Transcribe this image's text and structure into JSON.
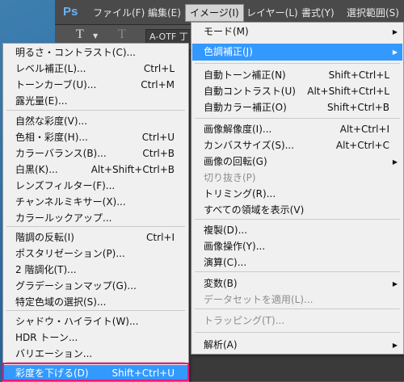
{
  "app": {
    "logo": "Ps"
  },
  "menubar": [
    {
      "label": "ファイル(F)",
      "active": false
    },
    {
      "label": "編集(E)",
      "active": false
    },
    {
      "label": "イメージ(I)",
      "active": true
    },
    {
      "label": "レイヤー(L)",
      "active": false
    },
    {
      "label": "書式(Y)",
      "active": false
    },
    {
      "label": "選択範囲(S)",
      "active": false
    }
  ],
  "options": {
    "font_field": "A-OTF 丁"
  },
  "image_menu": {
    "items": [
      {
        "label": "モード(M)",
        "submenu": true
      },
      {
        "label": "色調補正(J)",
        "submenu": true,
        "highlighted": true
      },
      {
        "label": "自動トーン補正(N)",
        "shortcut": "Shift+Ctrl+L"
      },
      {
        "label": "自動コントラスト(U)",
        "shortcut": "Alt+Shift+Ctrl+L"
      },
      {
        "label": "自動カラー補正(O)",
        "shortcut": "Shift+Ctrl+B"
      },
      {
        "label": "画像解像度(I)...",
        "shortcut": "Alt+Ctrl+I"
      },
      {
        "label": "カンバスサイズ(S)...",
        "shortcut": "Alt+Ctrl+C"
      },
      {
        "label": "画像の回転(G)",
        "submenu": true
      },
      {
        "label": "切り抜き(P)",
        "disabled": true
      },
      {
        "label": "トリミング(R)..."
      },
      {
        "label": "すべての領域を表示(V)"
      },
      {
        "label": "複製(D)..."
      },
      {
        "label": "画像操作(Y)..."
      },
      {
        "label": "演算(C)..."
      },
      {
        "label": "変数(B)",
        "submenu": true
      },
      {
        "label": "データセットを適用(L)...",
        "disabled": true
      },
      {
        "label": "トラッピング(T)...",
        "disabled": true
      },
      {
        "label": "解析(A)",
        "submenu": true
      }
    ]
  },
  "adjust_menu": {
    "items": [
      {
        "label": "明るさ・コントラスト(C)..."
      },
      {
        "label": "レベル補正(L)...",
        "shortcut": "Ctrl+L"
      },
      {
        "label": "トーンカーブ(U)...",
        "shortcut": "Ctrl+M"
      },
      {
        "label": "露光量(E)..."
      },
      {
        "label": "自然な彩度(V)..."
      },
      {
        "label": "色相・彩度(H)...",
        "shortcut": "Ctrl+U"
      },
      {
        "label": "カラーバランス(B)...",
        "shortcut": "Ctrl+B"
      },
      {
        "label": "白黒(K)...",
        "shortcut": "Alt+Shift+Ctrl+B"
      },
      {
        "label": "レンズフィルター(F)..."
      },
      {
        "label": "チャンネルミキサー(X)..."
      },
      {
        "label": "カラールックアップ..."
      },
      {
        "label": "階調の反転(I)",
        "shortcut": "Ctrl+I"
      },
      {
        "label": "ポスタリゼーション(P)..."
      },
      {
        "label": "2 階調化(T)..."
      },
      {
        "label": "グラデーションマップ(G)..."
      },
      {
        "label": "特定色域の選択(S)..."
      },
      {
        "label": "シャドウ・ハイライト(W)..."
      },
      {
        "label": "HDR トーン..."
      },
      {
        "label": "バリエーション..."
      },
      {
        "label": "彩度を下げる(D)",
        "shortcut": "Shift+Ctrl+U",
        "highlighted": true
      }
    ]
  },
  "colors": {
    "highlight": "#3399ff",
    "annotation": "#e8197d"
  }
}
